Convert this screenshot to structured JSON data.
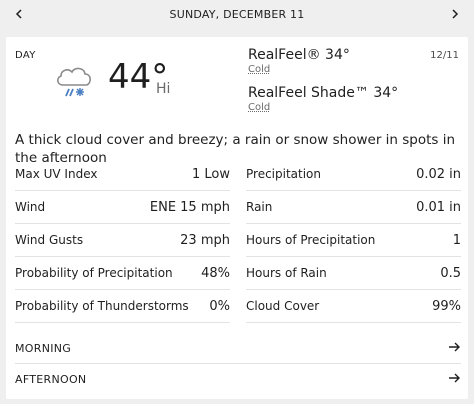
{
  "header": {
    "date": "SUNDAY, DECEMBER 11"
  },
  "card": {
    "day_label": "DAY",
    "date_short": "12/11",
    "temperature": "44°",
    "temp_suffix": "Hi",
    "icon": "cloud-rain-snow-icon",
    "realfeel": {
      "label": "RealFeel® 34°",
      "desc": "Cold"
    },
    "realfeel_shade": {
      "label": "RealFeel Shade™ 34°",
      "desc": "Cold"
    },
    "phrase": "A thick cloud cover and breezy; a rain or snow shower in spots in the afternoon"
  },
  "details": {
    "left": [
      {
        "label": "Max UV Index",
        "value": "1 Low"
      },
      {
        "label": "Wind",
        "value": "ENE 15 mph"
      },
      {
        "label": "Wind Gusts",
        "value": "23 mph"
      },
      {
        "label": "Probability of Precipitation",
        "value": "48%"
      },
      {
        "label": "Probability of Thunderstorms",
        "value": "0%"
      }
    ],
    "right": [
      {
        "label": "Precipitation",
        "value": "0.02 in"
      },
      {
        "label": "Rain",
        "value": "0.01 in"
      },
      {
        "label": "Hours of Precipitation",
        "value": "1"
      },
      {
        "label": "Hours of Rain",
        "value": "0.5"
      },
      {
        "label": "Cloud Cover",
        "value": "99%"
      }
    ]
  },
  "sections": {
    "morning": "MORNING",
    "afternoon": "AFTERNOON"
  },
  "colors": {
    "background": "#efefef",
    "card": "#ffffff",
    "icon_blue": "#4a7fc1",
    "icon_gray": "#8a8a8a"
  }
}
